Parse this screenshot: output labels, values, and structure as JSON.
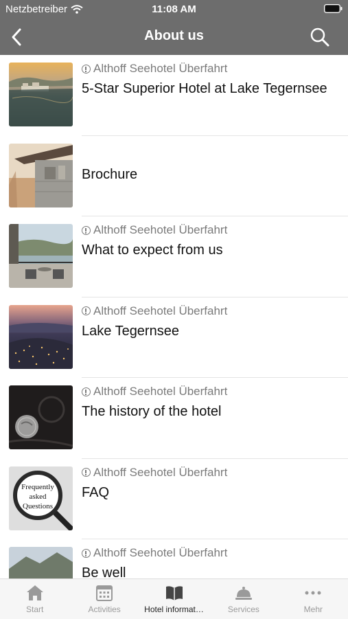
{
  "status_bar": {
    "carrier": "Netzbetreiber",
    "time": "11:08 AM"
  },
  "nav": {
    "title": "About us"
  },
  "items": [
    {
      "source": "Althoff Seehotel Überfahrt",
      "title": "5-Star Superior Hotel at Lake Tegernsee"
    },
    {
      "source": "",
      "title": "Brochure"
    },
    {
      "source": "Althoff Seehotel Überfahrt",
      "title": "What to expect from us"
    },
    {
      "source": "Althoff Seehotel Überfahrt",
      "title": "Lake Tegernsee"
    },
    {
      "source": "Althoff Seehotel Überfahrt",
      "title": "The history of the hotel"
    },
    {
      "source": "Althoff Seehotel Überfahrt",
      "title": "FAQ"
    },
    {
      "source": "Althoff Seehotel Überfahrt",
      "title": "Be well"
    }
  ],
  "faq_thumb": {
    "line1": "Frequently",
    "line2": "asked",
    "line3": "Questions"
  },
  "tabs": [
    {
      "label": "Start",
      "icon": "home-icon"
    },
    {
      "label": "Activities",
      "icon": "calendar-icon"
    },
    {
      "label": "Hotel informat…",
      "icon": "book-icon"
    },
    {
      "label": "Services",
      "icon": "bell-icon"
    },
    {
      "label": "Mehr",
      "icon": "more-icon"
    }
  ],
  "colors": {
    "header": "#6d6d6d",
    "active_tab": "#222222",
    "inactive_tab": "#9a9a9a"
  }
}
